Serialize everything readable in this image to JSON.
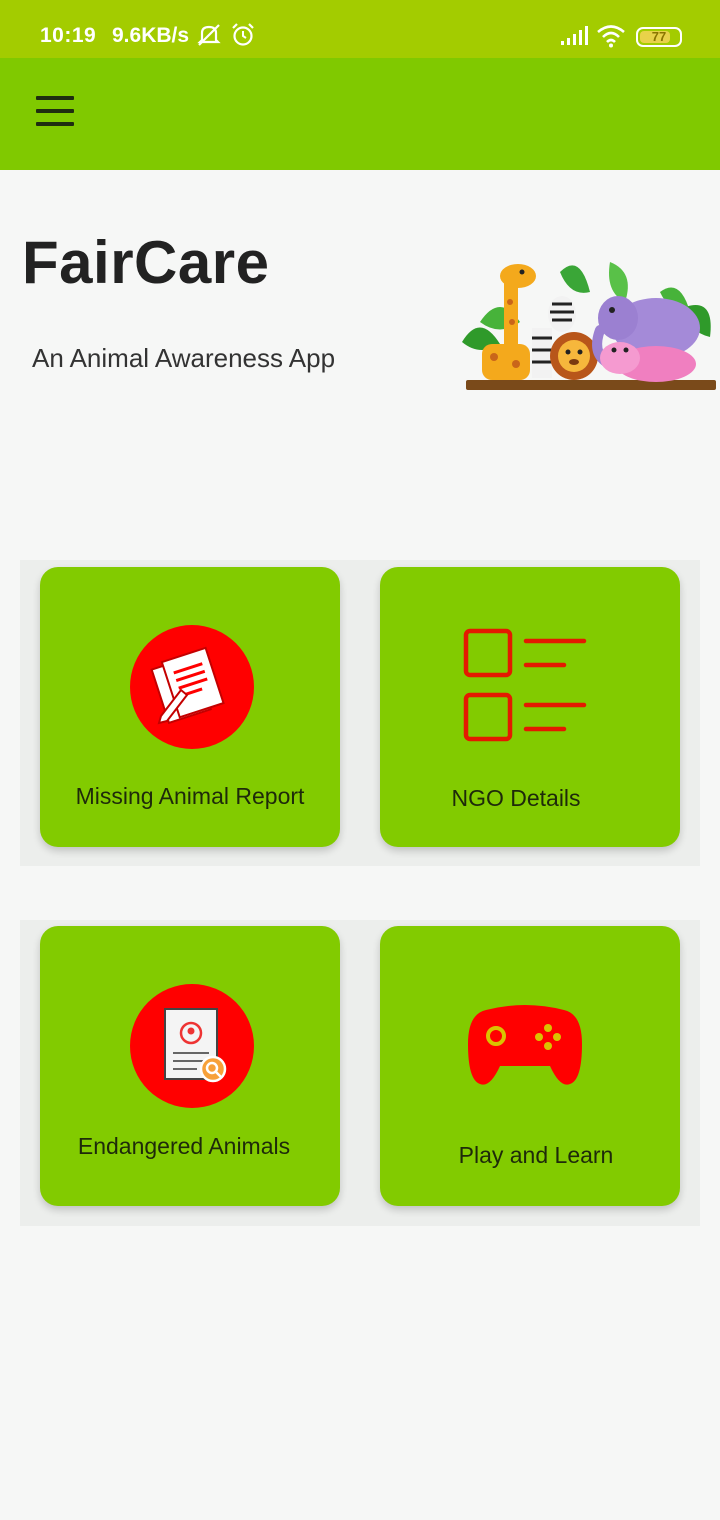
{
  "status_bar": {
    "time": "10:19",
    "speed": "9.6KB/s",
    "battery": "77",
    "icons": [
      "mute-icon",
      "alarm-icon",
      "signal-icon",
      "wifi-icon",
      "battery-icon"
    ]
  },
  "app_bar": {
    "menu_icon": "hamburger-menu-icon"
  },
  "header": {
    "title": "FairCare",
    "subtitle": "An Animal Awareness App"
  },
  "cards": [
    {
      "label": "Missing Animal Report",
      "icon": "document-edit-icon"
    },
    {
      "label": "NGO Details",
      "icon": "checklist-icon"
    },
    {
      "label": "Endangered Animals",
      "icon": "search-document-icon"
    },
    {
      "label": "Play and Learn",
      "icon": "gamepad-icon"
    }
  ],
  "colors": {
    "status_bar": "#a3cc00",
    "app_bar": "#80c900",
    "card": "#82cb00",
    "icon_red": "#ff0000",
    "background": "#f6f7f6"
  }
}
